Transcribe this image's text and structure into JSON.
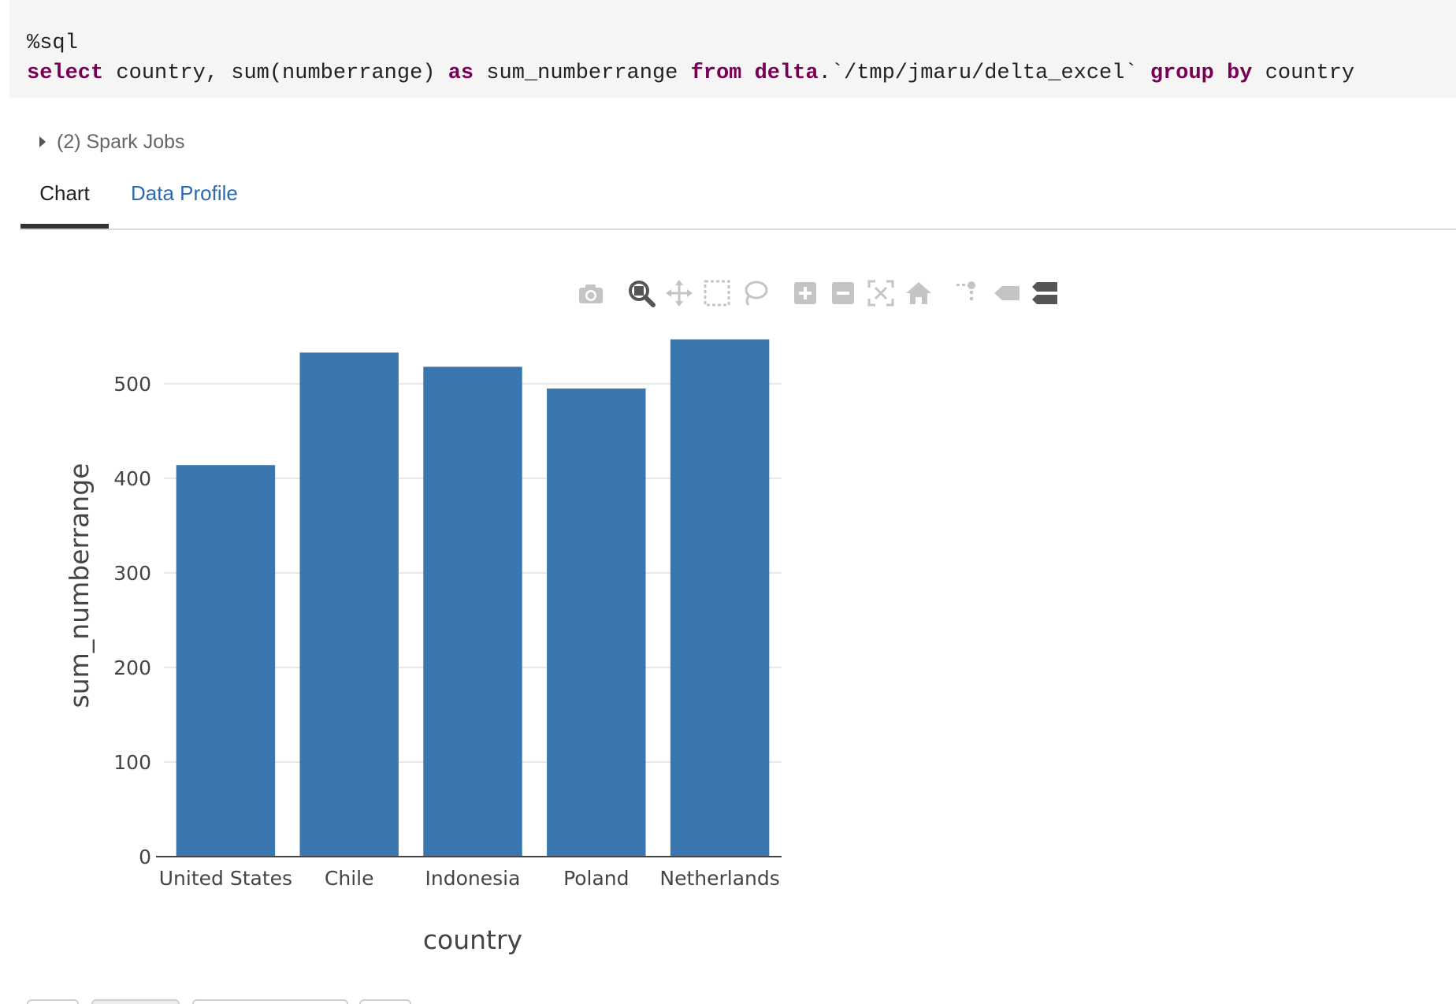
{
  "code": {
    "magic": "%sql",
    "tokens": [
      {
        "text": "select",
        "kw": true
      },
      {
        "text": " country, sum(numberrange) ",
        "kw": false
      },
      {
        "text": "as",
        "kw": true
      },
      {
        "text": " sum_numberrange ",
        "kw": false
      },
      {
        "text": "from",
        "kw": true
      },
      {
        "text": " ",
        "kw": false
      },
      {
        "text": "delta",
        "kw": true
      },
      {
        "text": ".`/tmp/jmaru/delta_excel` ",
        "kw": false
      },
      {
        "text": "group",
        "kw": true
      },
      {
        "text": " ",
        "kw": false
      },
      {
        "text": "by",
        "kw": true
      },
      {
        "text": " country",
        "kw": false
      }
    ]
  },
  "spark_jobs": {
    "label": "(2) Spark Jobs"
  },
  "tabs": [
    {
      "label": "Chart",
      "active": true
    },
    {
      "label": "Data Profile",
      "active": false
    }
  ],
  "modebar": {
    "icons": [
      "camera-icon",
      "zoom-icon",
      "pan-icon",
      "box-select-icon",
      "lasso-icon",
      "zoom-in-icon",
      "zoom-out-icon",
      "autoscale-icon",
      "home-icon",
      "spike-lines-icon",
      "hover-closest-icon",
      "hover-compare-icon"
    ],
    "active": "zoom-icon"
  },
  "chart_data": {
    "type": "bar",
    "categories": [
      "United States",
      "Chile",
      "Indonesia",
      "Poland",
      "Netherlands"
    ],
    "values": [
      414,
      533,
      518,
      495,
      547
    ],
    "xlabel": "country",
    "ylabel": "sum_numberrange",
    "ylim": [
      0,
      550
    ],
    "yticks": [
      0,
      100,
      200,
      300,
      400,
      500
    ],
    "grid": true,
    "bar_color": "#3a76af"
  }
}
